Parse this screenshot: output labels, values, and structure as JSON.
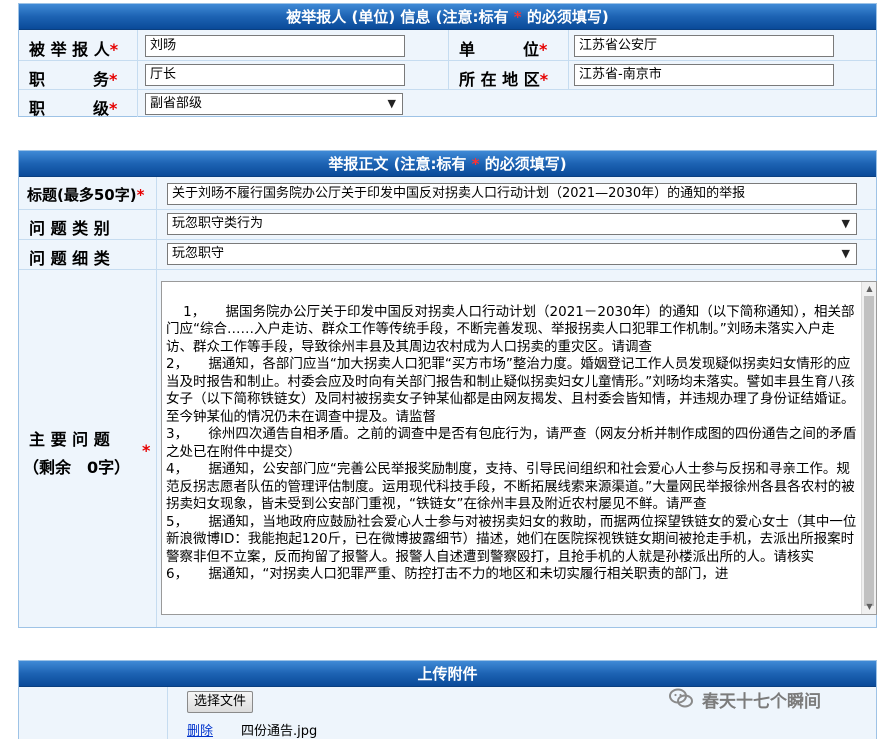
{
  "section1": {
    "header_prefix": "被举报人 (单位) 信息 (注意:标有 ",
    "header_star": "*",
    "header_suffix": " 的必须填写)",
    "rows": {
      "name_label": "被 举 报 人",
      "name_value": "刘旸",
      "unit_label": "单　　　位",
      "unit_value": "江苏省公安厅",
      "position_label": "职　　　务",
      "position_value": "厅长",
      "region_label": "所 在 地 区",
      "region_value": "江苏省-南京市",
      "rank_label": "职　　　级",
      "rank_value": "副省部级"
    },
    "required_star": "*"
  },
  "section2": {
    "header_prefix": "举报正文 (注意:标有 ",
    "header_star": "*",
    "header_suffix": " 的必须填写)",
    "title_label": "标题(最多50字)",
    "title_value": "关于刘旸不履行国务院办公厅关于印发中国反对拐卖人口行动计划（2021—2030年）的通知的举报",
    "category_label": "问 题 类 别",
    "category_value": "玩忽职守类行为",
    "detail_label": "问 题 细 类",
    "detail_value": "玩忽职守",
    "main_label_line1": "主 要 问 题",
    "main_label_line2": "（剩余　0字）",
    "main_text": "1，　　据国务院办公厅关于印发中国反对拐卖人口行动计划（2021－2030年）的通知（以下简称通知），相关部门应“综合……入户走访、群众工作等传统手段，不断完善发现、举报拐卖人口犯罪工作机制。”刘旸未落实入户走访、群众工作等手段，导致徐州丰县及其周边农村成为人口拐卖的重灾区。请调查\n2，　　据通知，各部门应当“加大拐卖人口犯罪“买方市场”整治力度。婚姻登记工作人员发现疑似拐卖妇女情形的应当及时报告和制止。村委会应及时向有关部门报告和制止疑似拐卖妇女儿童情形。”刘旸均未落实。譬如丰县生育八孩女子（以下简称铁链女）及同村被拐卖女子钟某仙都是由网友揭发、且村委会皆知情，并违规办理了身份证结婚证。至今钟某仙的情况仍未在调查中提及。请监督\n3，　　徐州四次通告自相矛盾。之前的调查中是否有包庇行为，请严查（网友分析并制作成图的四份通告之间的矛盾之处已在附件中提交）\n4，　　据通知，公安部门应“完善公民举报奖励制度，支持、引导民间组织和社会爱心人士参与反拐和寻亲工作。规范反拐志愿者队伍的管理评估制度。运用现代科技手段，不断拓展线索来源渠道。”大量网民举报徐州各县各农村的被拐卖妇女现象，皆未受到公安部门重视，“铁链女”在徐州丰县及附近农村屡见不鲜。请严查\n5，　　据通知，当地政府应鼓励社会爱心人士参与对被拐卖妇女的救助，而据两位探望铁链女的爱心女士（其中一位新浪微博ID：我能抱起120斤，已在微博披露细节）描述，她们在医院探视铁链女期间被抢走手机，去派出所报案时警察非但不立案，反而拘留了报警人。报警人自述遭到警察殴打，且抢手机的人就是孙楼派出所的人。请核实\n6，　　据通知，“对拐卖人口犯罪严重、防控打击不力的地区和未切实履行相关职责的部门，进"
  },
  "section3": {
    "header": "上传附件",
    "choose_file_label": "选择文件",
    "delete_link": "删除",
    "file_name": "四份通告.jpg"
  },
  "watermark": "春天十七个瞬间"
}
